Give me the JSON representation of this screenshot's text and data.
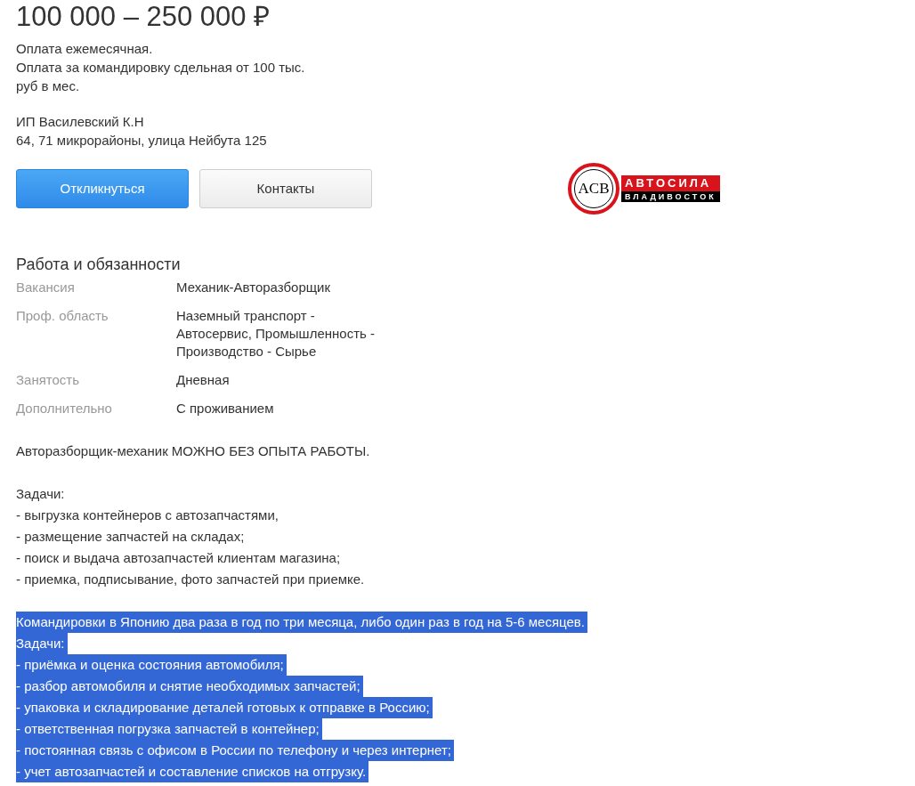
{
  "salary": "100 000 – 250 000 ₽",
  "salary_note": [
    "Оплата ежемесячная.",
    "Оплата за командировку сдельная от 100 тыс.",
    "руб в мес."
  ],
  "employer": {
    "name": "ИП Василевский К.Н",
    "address": "64, 71 микрорайоны, улица Нейбута 125"
  },
  "buttons": [
    {
      "label": "Откликнуться",
      "kind": "primary"
    },
    {
      "label": "Контакты",
      "kind": "secondary"
    }
  ],
  "logo": {
    "monogram": "ACB",
    "brand": "АВТОСИЛА",
    "city": "ВЛАДИВОСТОК"
  },
  "section": {
    "title": "Работа и обязанности",
    "rows": [
      {
        "label": "Вакансия",
        "value": [
          "Механик-Авторазборщик"
        ]
      },
      {
        "label": "Проф. область",
        "value": [
          "Наземный транспорт -",
          "Автосервис, Промышленность -",
          "Производство - Сырье"
        ]
      },
      {
        "label": "Занятость",
        "value": [
          "Дневная"
        ]
      },
      {
        "label": "Дополнительно",
        "value": [
          "С проживанием"
        ]
      }
    ]
  },
  "description": [
    {
      "highlighted": false,
      "lines": [
        "Авторазборщик-механик МОЖНО БЕЗ ОПЫТА РАБОТЫ."
      ]
    },
    {
      "highlighted": false,
      "lines": [
        "Задачи:",
        "- выгрузка контейнеров с автозапчастями,",
        "- размещение запчастей на складах;",
        "- поиск и выдача автозапчастей клиентам магазина;",
        "- приемка, подписывание, фото запчастей при приемке."
      ]
    },
    {
      "highlighted": true,
      "lines": [
        "Командировки в Японию два раза в год по три месяца, либо один раз в год на 5-6 месяцев.",
        "Задачи:",
        "- приёмка и оценка состояния автомобиля;",
        "- разбор автомобиля и снятие необходимых запчастей;",
        "- упаковка и складирование деталей готовых к отправке в Россию;",
        "- ответственная погрузка запчастей в контейнер;",
        "- постоянная связь с офисом в России по телефону и через интернет;",
        "- учет автозапчастей и составление списков на отгрузку."
      ]
    }
  ]
}
